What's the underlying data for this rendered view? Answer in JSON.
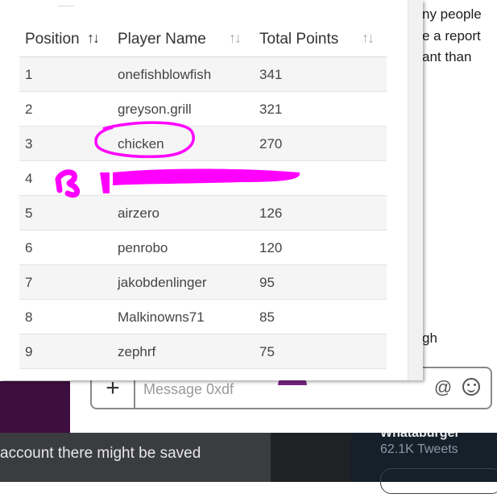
{
  "background_chat": {
    "snippets": [
      "ny people",
      "e a report",
      "ant than",
      "gh"
    ],
    "composer_placeholder": "Message 0xdf",
    "plus_label": "+",
    "at_label": "@"
  },
  "bottom_left": {
    "text": "account there might be saved"
  },
  "bottom_right": {
    "name": "Whataburger",
    "tweets": "62.1K Tweets"
  },
  "leaderboard": {
    "headers": {
      "position": "Position",
      "player": "Player Name",
      "points": "Total Points"
    },
    "sort_glyph": "↑↓",
    "rows": [
      {
        "position": "1",
        "player": "onefishblowfish",
        "points": "341"
      },
      {
        "position": "2",
        "player": "greyson.grill",
        "points": "321"
      },
      {
        "position": "3",
        "player": "chicken",
        "points": "270"
      },
      {
        "position": "4",
        "player": "",
        "points": ""
      },
      {
        "position": "5",
        "player": "airzero",
        "points": "126"
      },
      {
        "position": "6",
        "player": "penrobo",
        "points": "120"
      },
      {
        "position": "7",
        "player": "jakobdenlinger",
        "points": "95"
      },
      {
        "position": "8",
        "player": "Malkinowns71",
        "points": "85"
      },
      {
        "position": "9",
        "player": "zephrf",
        "points": "75"
      }
    ]
  },
  "colors": {
    "annotation": "#ff00ff",
    "sidebar": "#3f0e40",
    "accent_purple": "#7a2583"
  }
}
